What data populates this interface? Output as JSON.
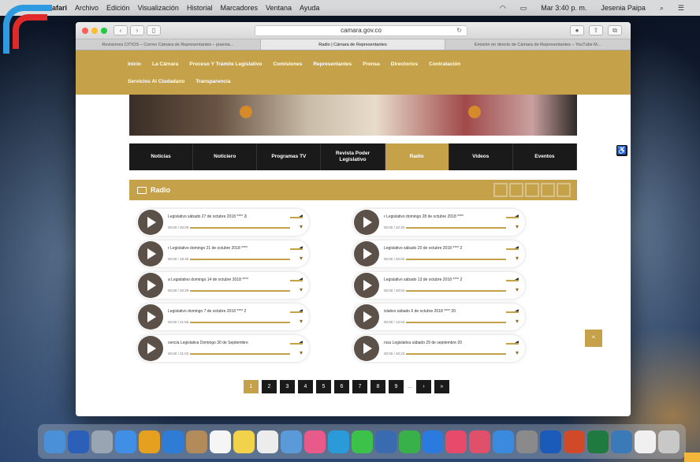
{
  "menubar": {
    "app": "Safari",
    "items": [
      "Archivo",
      "Edición",
      "Visualización",
      "Historial",
      "Marcadores",
      "Ventana",
      "Ayuda"
    ],
    "clock": "Mar 3:40 p. m.",
    "user": "Jesenia Paipa"
  },
  "browser": {
    "url": "camara.gov.co",
    "tabs": [
      "Revisiones CITIOS – Correo Cámara de Representantes – jesenia...",
      "Radio | Cámara de Representantes",
      "Emisión en directo de Cámara de Representantes – YouTube  M..."
    ]
  },
  "site_nav": {
    "row1": [
      "Inicio",
      "La Cámara",
      "Proceso Y Trámite Legislativo",
      "Comisiones",
      "Representantes",
      "Prensa",
      "Directorios",
      "Contratación"
    ],
    "row2": [
      "Servicios Al Ciudadano",
      "Transparencia"
    ]
  },
  "subnav": [
    "Noticias",
    "Noticiero",
    "Programas TV",
    "Revista Poder Legislativo",
    "Radio",
    "Videos",
    "Eventos"
  ],
  "section": {
    "title": "Radio"
  },
  "players_left": [
    {
      "title": "Legislativo sábado 27 de octubre 2018 ****  2i",
      "time": "00:00 / 20:00"
    },
    {
      "title": "r Legislativo domingo 21 de octubre 2018 ****",
      "time": "00:00 / 19:45"
    },
    {
      "title": "a Legislativo domingo 14 de octubre 2018 ****",
      "time": "00:00 / 20:29"
    },
    {
      "title": "Legislativo domingo 7 de octubre 2018 **** 2",
      "time": "00:00 / 21:55"
    },
    {
      "title": "cencia Legislativa Domingo 30 de Septiembre",
      "time": "00:00 / 21:02"
    }
  ],
  "players_right": [
    {
      "title": "r Legislativo domingo 28 de octubre 2018 ****",
      "time": "00:00 / 20:40"
    },
    {
      "title": "Legislativo sábado 20 de octubre 2018 **** 2",
      "time": "00:00 / 20:02"
    },
    {
      "title": "Legislativo sábado 13 de octubre 2018 **** 2",
      "time": "00:00 / 20:04"
    },
    {
      "title": "islativo sábado 6 de octubre 2018 **** 20",
      "time": "00:00 / 13:04"
    },
    {
      "title": "ncia Legislativa sábado 29 de septiembre 20",
      "time": "00:00 / 20:23"
    }
  ],
  "pager": {
    "pages": [
      "1",
      "2",
      "3",
      "4",
      "5",
      "6",
      "7",
      "8",
      "9"
    ],
    "ellipsis": "...",
    "next": "›",
    "last": "»"
  },
  "colors": {
    "gold": "#c5a24a",
    "dark": "#1a1a1a"
  }
}
